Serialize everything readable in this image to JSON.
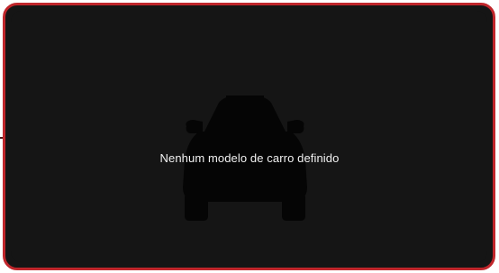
{
  "empty_state": {
    "message": "Nenhum modelo de carro definido",
    "icon": "car-silhouette-icon"
  },
  "colors": {
    "border": "#c0262b",
    "panel": "#151515",
    "car_silhouette": "#050505",
    "text": "#f2f2f2"
  }
}
